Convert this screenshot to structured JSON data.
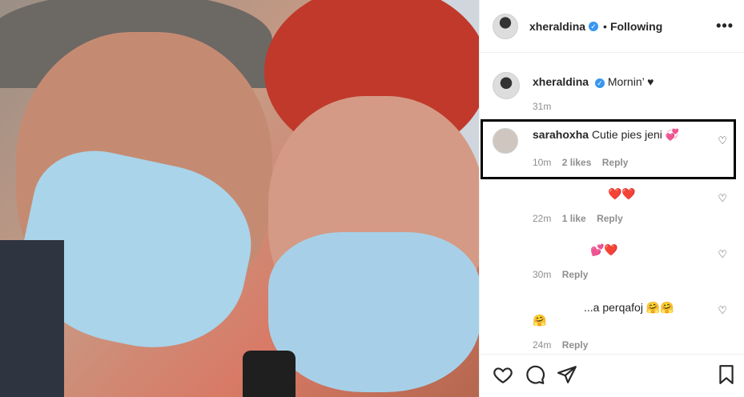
{
  "header": {
    "username": "xheraldina",
    "separator": "•",
    "follow_status": "Following",
    "more_label": "•••"
  },
  "caption": {
    "username": "xheraldina",
    "text": "Mornin’ ♥",
    "time": "31m"
  },
  "comments": [
    {
      "username": "sarahoxha",
      "text": "Cutie pies jeni 💞",
      "time": "10m",
      "likes": "2 likes",
      "reply": "Reply"
    },
    {
      "username": "",
      "text": "❤️❤️",
      "time": "22m",
      "likes": "1 like",
      "reply": "Reply"
    },
    {
      "username": "",
      "text": "💕❤️",
      "time": "30m",
      "likes": "",
      "reply": "Reply"
    },
    {
      "username": "",
      "text": "...a perqafoj 🤗🤗",
      "text_line2": "🤗",
      "time": "24m",
      "likes": "",
      "reply": "Reply"
    }
  ],
  "icons": {
    "verified": "verified-badge",
    "like": "heart-outline",
    "comment": "comment-bubble",
    "share": "paper-plane",
    "save": "bookmark"
  },
  "colors": {
    "verified": "#3897f0",
    "meta": "#8e8e8e",
    "highlight_border": "#000000"
  }
}
